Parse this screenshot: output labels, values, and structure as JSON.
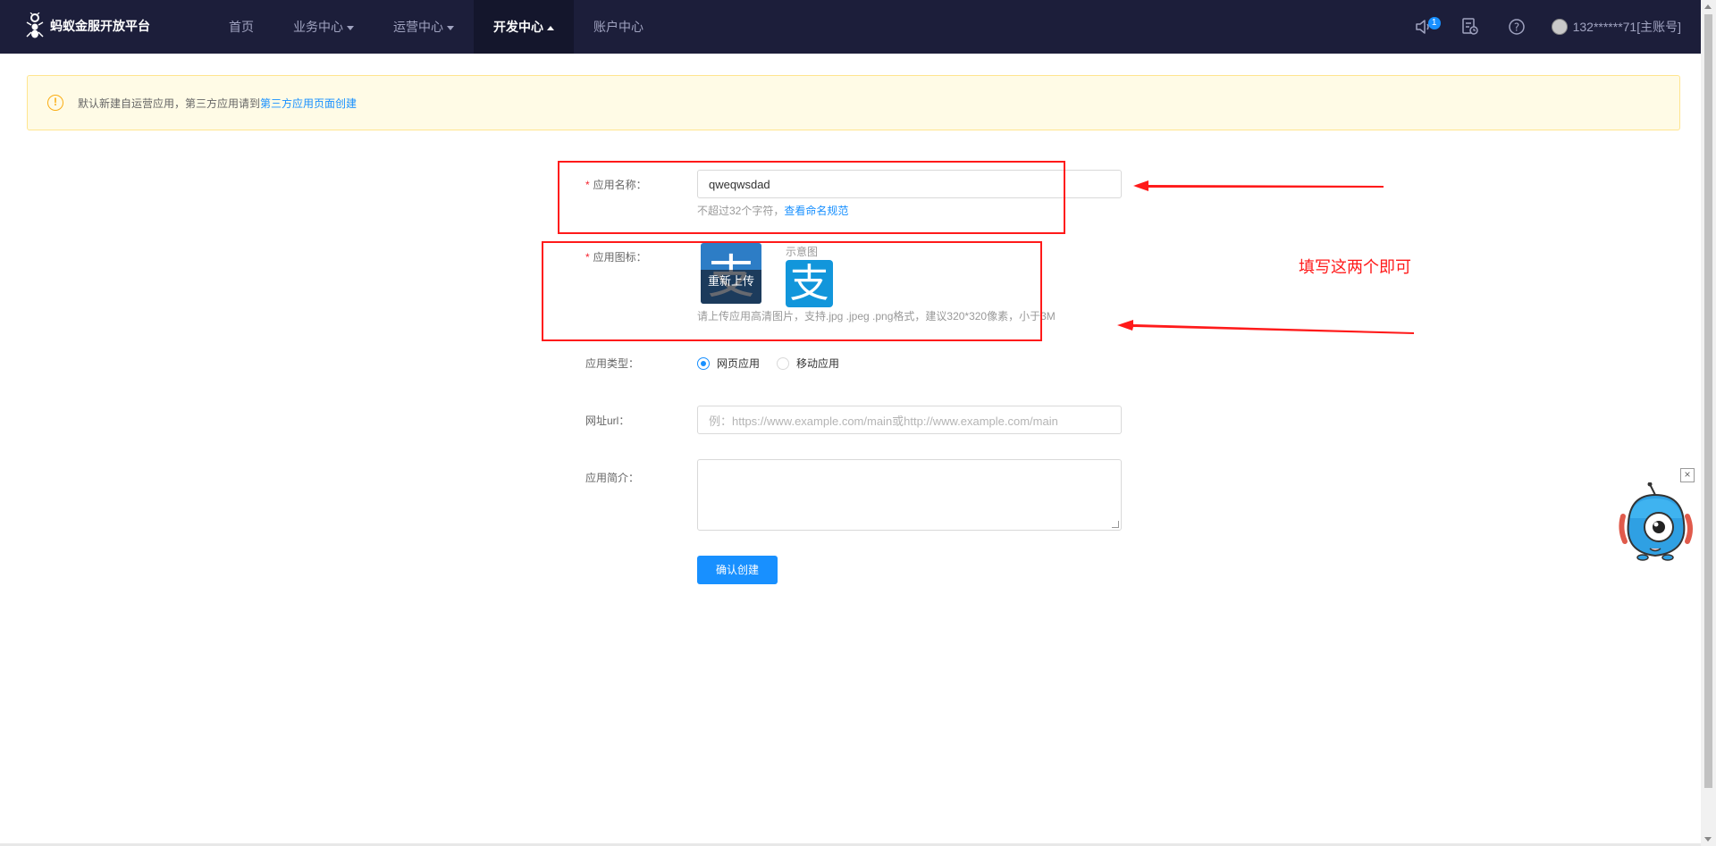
{
  "header": {
    "brand": "蚂蚁金服开放平台",
    "nav": [
      {
        "label": "首页",
        "dropdown": false,
        "active": false
      },
      {
        "label": "业务中心",
        "dropdown": true,
        "active": false
      },
      {
        "label": "运营中心",
        "dropdown": true,
        "active": false
      },
      {
        "label": "开发中心",
        "dropdown": true,
        "active": true
      },
      {
        "label": "账户中心",
        "dropdown": false,
        "active": false
      }
    ],
    "notification_count": "1",
    "account": "132******71[主账号]"
  },
  "notice": {
    "text": "默认新建自运营应用，第三方应用请到",
    "link": "第三方应用页面创建"
  },
  "form": {
    "app_name": {
      "label": "应用名称：",
      "value": "qweqwsdad",
      "hint": "不超过32个字符，",
      "hint_link": "查看命名规范"
    },
    "app_icon": {
      "label": "应用图标：",
      "reupload": "重新上传",
      "sample_label": "示意图",
      "hint": "请上传应用高清图片，支持.jpg .jpeg .png格式，建议320*320像素，小于3M"
    },
    "app_type": {
      "label": "应用类型：",
      "options": [
        "网页应用",
        "移动应用"
      ],
      "selected": "网页应用"
    },
    "url": {
      "label": "网址url：",
      "placeholder": "例：https://www.example.com/main或http://www.example.com/main"
    },
    "intro": {
      "label": "应用简介："
    },
    "submit": "确认创建"
  },
  "annotation": {
    "note": "填写这两个即可"
  },
  "colors": {
    "header_bg": "#1c1e3a",
    "primary": "#1890ff",
    "annotation_red": "#ff1a1a",
    "notice_bg": "#fffbe6"
  }
}
